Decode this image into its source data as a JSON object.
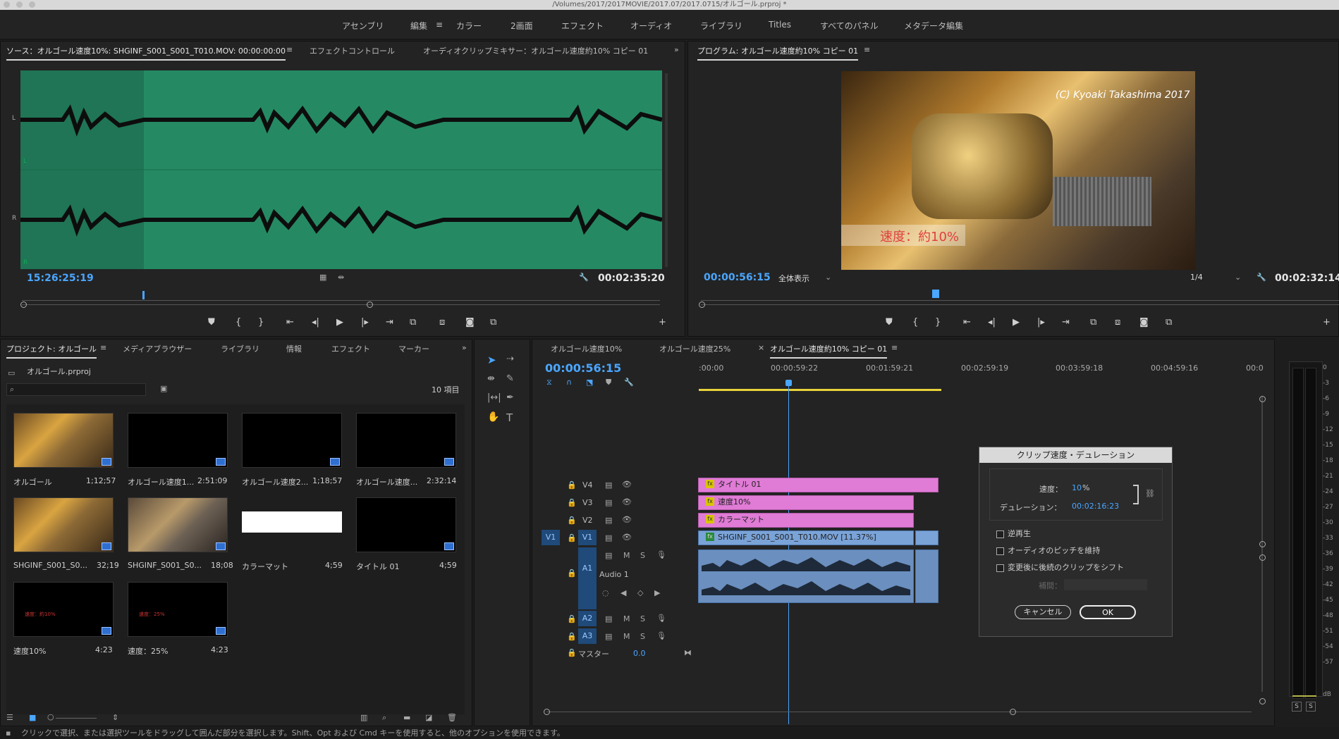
{
  "window": {
    "title": "/Volumes/2017/2017MOVIE/2017.07/2017.0715/オルゴール.prproj *"
  },
  "workspaces": [
    "アセンブリ",
    "編集",
    "カラー",
    "2画面",
    "エフェクト",
    "オーディオ",
    "ライブラリ",
    "Titles",
    "すべてのパネル",
    "メタデータ編集"
  ],
  "source_panel": {
    "tabs": [
      "ソース：オルゴール速度10%: SHGINF_S001_S001_T010.MOV: 00:00:00:00",
      "エフェクトコントロール",
      "オーディオクリップミキサー：オルゴール速度約10% コピー 01"
    ],
    "timecode_left": "15:26:25:19",
    "timecode_right": "00:02:35:20",
    "channel_labels": [
      "L",
      "L",
      "R",
      "R"
    ]
  },
  "program_panel": {
    "title": "プログラム: オルゴール速度約10% コピー 01",
    "watermark": "(C) Kyoaki Takashima 2017",
    "overlay_text": "速度：約10%",
    "timecode_left": "00:00:56:15",
    "fit_label": "全体表示",
    "resolution": "1/4",
    "timecode_right": "00:02:32:14"
  },
  "project_panel": {
    "tabs": [
      "プロジェクト: オルゴール",
      "メディアブラウザー",
      "ライブラリ",
      "情報",
      "エフェクト",
      "マーカー"
    ],
    "file": "オルゴール.prproj",
    "count": "10 項目",
    "items": [
      {
        "name": "オルゴール",
        "dur": "1;12;57"
      },
      {
        "name": "オルゴール速度1...",
        "dur": "2:51:09"
      },
      {
        "name": "オルゴール速度2...",
        "dur": "1;18;57"
      },
      {
        "name": "オルゴール速度...",
        "dur": "2:32:14"
      },
      {
        "name": "SHGINF_S001_S0...",
        "dur": "32;19"
      },
      {
        "name": "SHGINF_S001_S0...",
        "dur": "18;08"
      },
      {
        "name": "カラーマット",
        "dur": "4;59"
      },
      {
        "name": "タイトル 01",
        "dur": "4;59"
      },
      {
        "name": "速度10%",
        "dur": "4:23"
      },
      {
        "name": "速度：25%",
        "dur": "4:23"
      }
    ],
    "thumb_red_text": [
      "速度：約10%",
      "速度：25%"
    ]
  },
  "timeline": {
    "tabs": [
      "オルゴール速度10%",
      "オルゴール速度25%",
      "オルゴール速度約10% コピー 01"
    ],
    "timecode": "00:00:56:15",
    "ruler": [
      ":00:00",
      "00:00:59:22",
      "00:01:59:21",
      "00:02:59:19",
      "00:03:59:18",
      "00:04:59:16",
      "00:0"
    ],
    "tracks": {
      "v4": "V4",
      "v3": "V3",
      "v2": "V2",
      "v1": "V1",
      "a1": "A1",
      "a2": "A2",
      "a3": "A3",
      "audio1": "Audio 1",
      "master": "マスター",
      "master_val": "0.0",
      "src_v1": "V1"
    },
    "ms": [
      "M",
      "S"
    ],
    "clips": {
      "title": "タイトル 01",
      "speed": "速度10%",
      "matte": "カラーマット",
      "video": "SHGINF_S001_S001_T010.MOV [11.37%]"
    }
  },
  "dialog": {
    "title": "クリップ速度・デュレーション",
    "speed_label": "速度：",
    "speed_value": "10",
    "speed_unit": "%",
    "duration_label": "デュレーション：",
    "duration_value": "00:02:16:23",
    "options": [
      "逆再生",
      "オーディオのピッチを維持",
      "変更後に後続のクリップをシフト"
    ],
    "interp_label": "補間：",
    "cancel": "キャンセル",
    "ok": "OK"
  },
  "meter": {
    "labels": [
      "0",
      "-3",
      "-6",
      "-9",
      "-12",
      "-15",
      "-18",
      "-21",
      "-24",
      "-27",
      "-30",
      "-33",
      "-36",
      "-39",
      "-42",
      "-45",
      "-48",
      "-51",
      "-54",
      "-57",
      "dB"
    ],
    "s1": "S",
    "s2": "S"
  },
  "status": "クリックで選択、または選択ツールをドラッグして囲んだ部分を選択します。Shift、Opt および Cmd キーを使用すると、他のオプションを使用できます。"
}
